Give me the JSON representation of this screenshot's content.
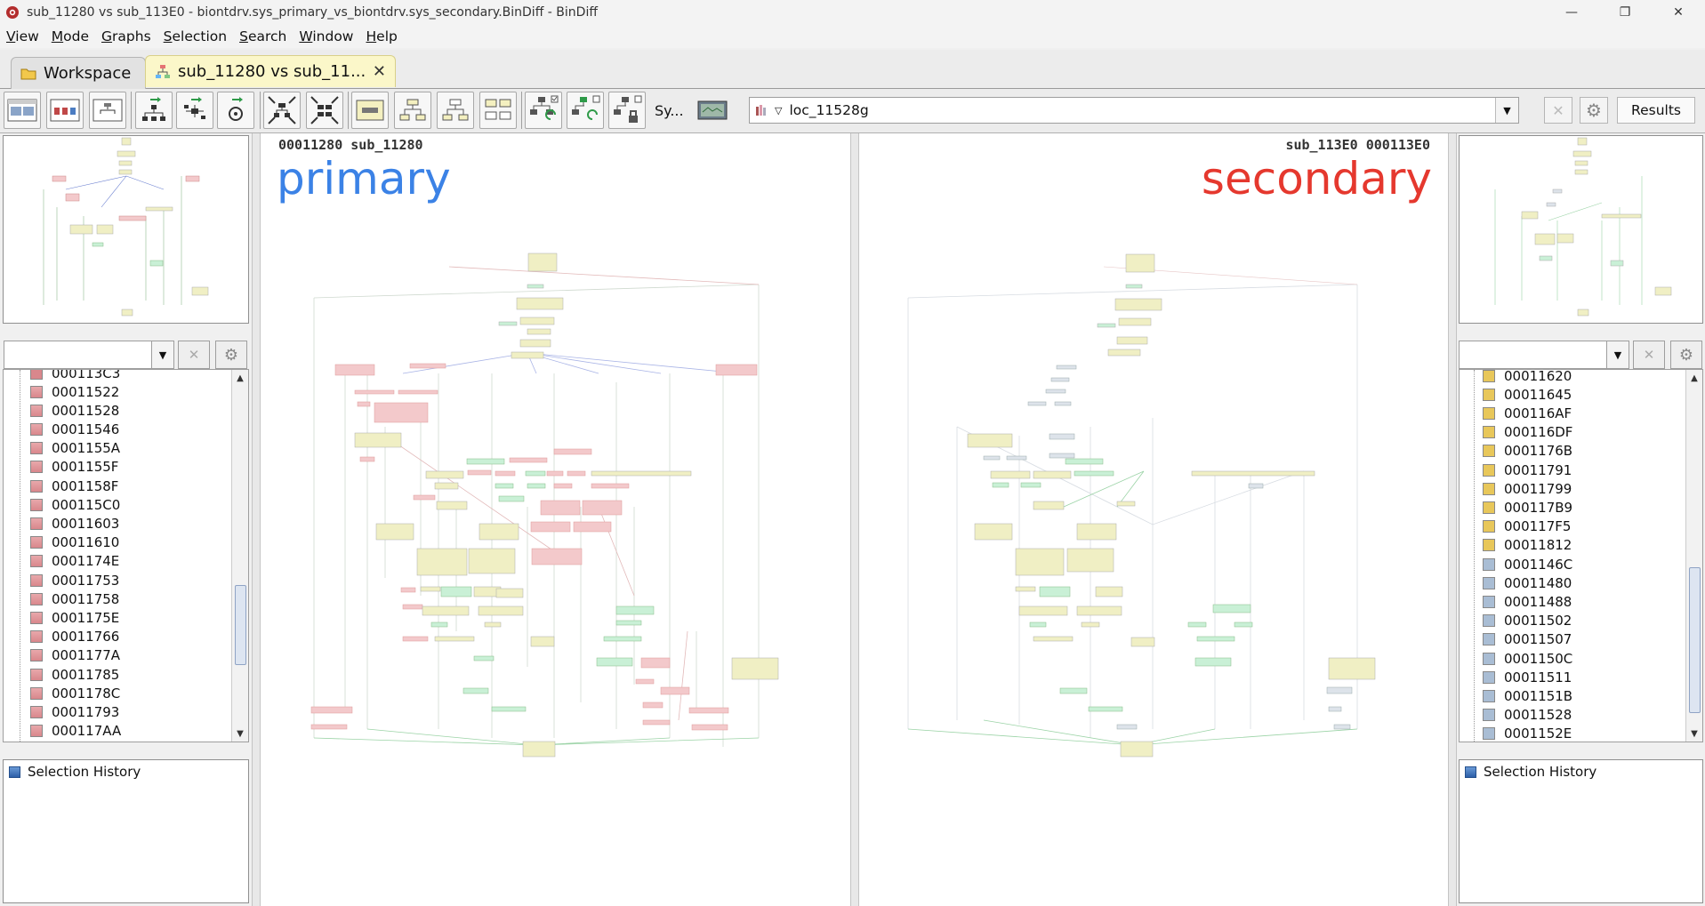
{
  "window": {
    "title": "sub_11280 vs sub_113E0 - biontdrv.sys_primary_vs_biontdrv.sys_secondary.BinDiff - BinDiff",
    "min_label": "—",
    "max_label": "❐",
    "close_label": "✕"
  },
  "menu": [
    {
      "first": "V",
      "rest": "iew"
    },
    {
      "first": "M",
      "rest": "ode"
    },
    {
      "first": "G",
      "rest": "raphs"
    },
    {
      "first": "S",
      "rest": "election"
    },
    {
      "first": "S",
      "rest": "earch"
    },
    {
      "first": "W",
      "rest": "indow"
    },
    {
      "first": "H",
      "rest": "elp"
    }
  ],
  "tabs": {
    "workspace": "Workspace",
    "diff": "sub_11280 vs sub_11...",
    "close": "✕"
  },
  "toolbar": {
    "sync_label": "Sy...",
    "address_value": "loc_11528g",
    "results_label": "Results"
  },
  "primary": {
    "header": "00011280 sub_11280",
    "label": "primary",
    "color": "#3b82e6"
  },
  "secondary": {
    "header": "sub_113E0 000113E0",
    "label": "secondary",
    "color": "#e5382e"
  },
  "left_list": {
    "partial_top": "000113C3",
    "items": [
      "00011522",
      "00011528",
      "00011546",
      "0001155A",
      "0001155F",
      "0001158F",
      "000115C0",
      "00011603",
      "00011610",
      "0001174E",
      "00011753",
      "00011758",
      "0001175E",
      "00011766",
      "0001177A",
      "00011785",
      "0001178C",
      "00011793",
      "000117AA"
    ],
    "swatch_color": "#d9878c"
  },
  "right_list": {
    "items_yellow": [
      "00011620",
      "00011645",
      "000116AF",
      "000116DF",
      "0001176B",
      "00011791",
      "00011799",
      "000117B9",
      "000117F5",
      "00011812"
    ],
    "items_gray": [
      "0001146C",
      "00011480",
      "00011488",
      "00011502",
      "00011507",
      "0001150C",
      "00011511",
      "0001151B",
      "00011528",
      "0001152E"
    ],
    "yellow_color": "#e8c75a",
    "gray_color": "#a9bdd4"
  },
  "history": {
    "left_label": "Selection History",
    "right_label": "Selection History"
  },
  "colors": {
    "node_yellow": "#f0efc4",
    "node_red": "#f3c9cb",
    "node_green": "#c9f0d6",
    "node_gray": "#dde3ea"
  }
}
